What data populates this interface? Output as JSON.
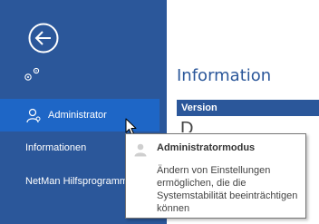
{
  "sidebar": {
    "back_icon": "back-arrow-icon",
    "gear_icon": "gears-icon",
    "items": [
      {
        "label": "Administrator",
        "icon": "user-icon",
        "selected": true
      },
      {
        "label": "Informationen",
        "selected": false
      },
      {
        "label": "NetMan Hilfsprogramme",
        "selected": false
      }
    ]
  },
  "content": {
    "title": "Information",
    "version_label": "Version",
    "partial_text": "D"
  },
  "tooltip": {
    "title": "Administratormodus",
    "body": "Ändern von Einstellungen ermöglichen, die die Systemstabilität beeinträchtigen können"
  },
  "colors": {
    "sidebar_bg": "#2b579a",
    "selected_bg": "#1e66c6",
    "accent": "#2b579a"
  }
}
